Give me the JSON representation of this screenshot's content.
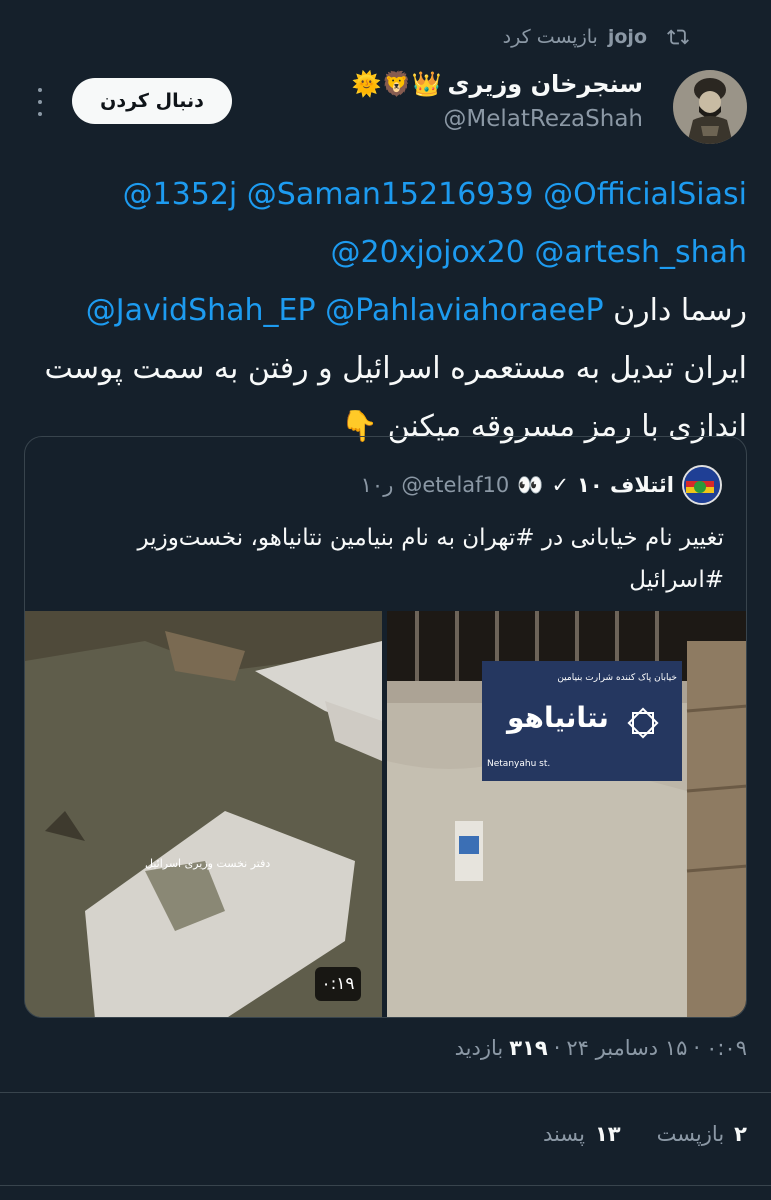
{
  "repost": {
    "user": "jojo",
    "label": "بازپست کرد"
  },
  "author": {
    "display_name": "سنجرخان وزیری",
    "emoji": "👑🦁🌞",
    "handle": "@MelatRezaShah"
  },
  "follow_button": "دنبال کردن",
  "tweet": {
    "mention_1352j": "@1352j",
    "mention_saman": "@Saman15216939",
    "mention_siasi": "@OfficialSiasi",
    "mention_jojox": "@20xjojox20",
    "mention_artesh": "@artesh_shah",
    "mention_javid": "@JavidShah_EP",
    "mention_pahlavi": "@PahlaviahoraeeP",
    "text_1": "رسما دارن",
    "text_2": "ایران تبدیل به مستعمره اسرائیل و رفتن به سمت پوست",
    "text_3": "اندازی با رمز مسروقه میکنن",
    "emoji": "👇"
  },
  "quote": {
    "name": "ائتلاف ۱۰",
    "badge": "✓",
    "eyes": "👀",
    "handle": "@etelaf10",
    "time": "۱۰ر",
    "text_1": "تغییر نام خیابانی در #تهران به نام بنیامین نتانیاهو، نخست‌وزیر",
    "text_2": "#اسرائیل",
    "video_caption": "دفتر نخست وزیری اسرائیل",
    "video_duration": "۰:۱۹",
    "sign_top": "خیابان پاک کننده شرارت بنیامین",
    "sign_main": "نتانیاهو",
    "sign_latin": "Netanyahu st."
  },
  "meta": {
    "time": "۰:۰۹",
    "dot1": "·",
    "date": "۱۵ دسامبر ۲۴",
    "dot2": "·",
    "views": "۳۱۹",
    "views_label": "بازدید"
  },
  "stats": {
    "reposts_count": "۲",
    "reposts_label": "بازپست",
    "likes_count": "۱۳",
    "likes_label": "پسند"
  },
  "colors": {
    "background": "#15202b",
    "mention": "#1d9bf0",
    "secondary": "#8b98a5",
    "primary": "#f7f9f9"
  }
}
